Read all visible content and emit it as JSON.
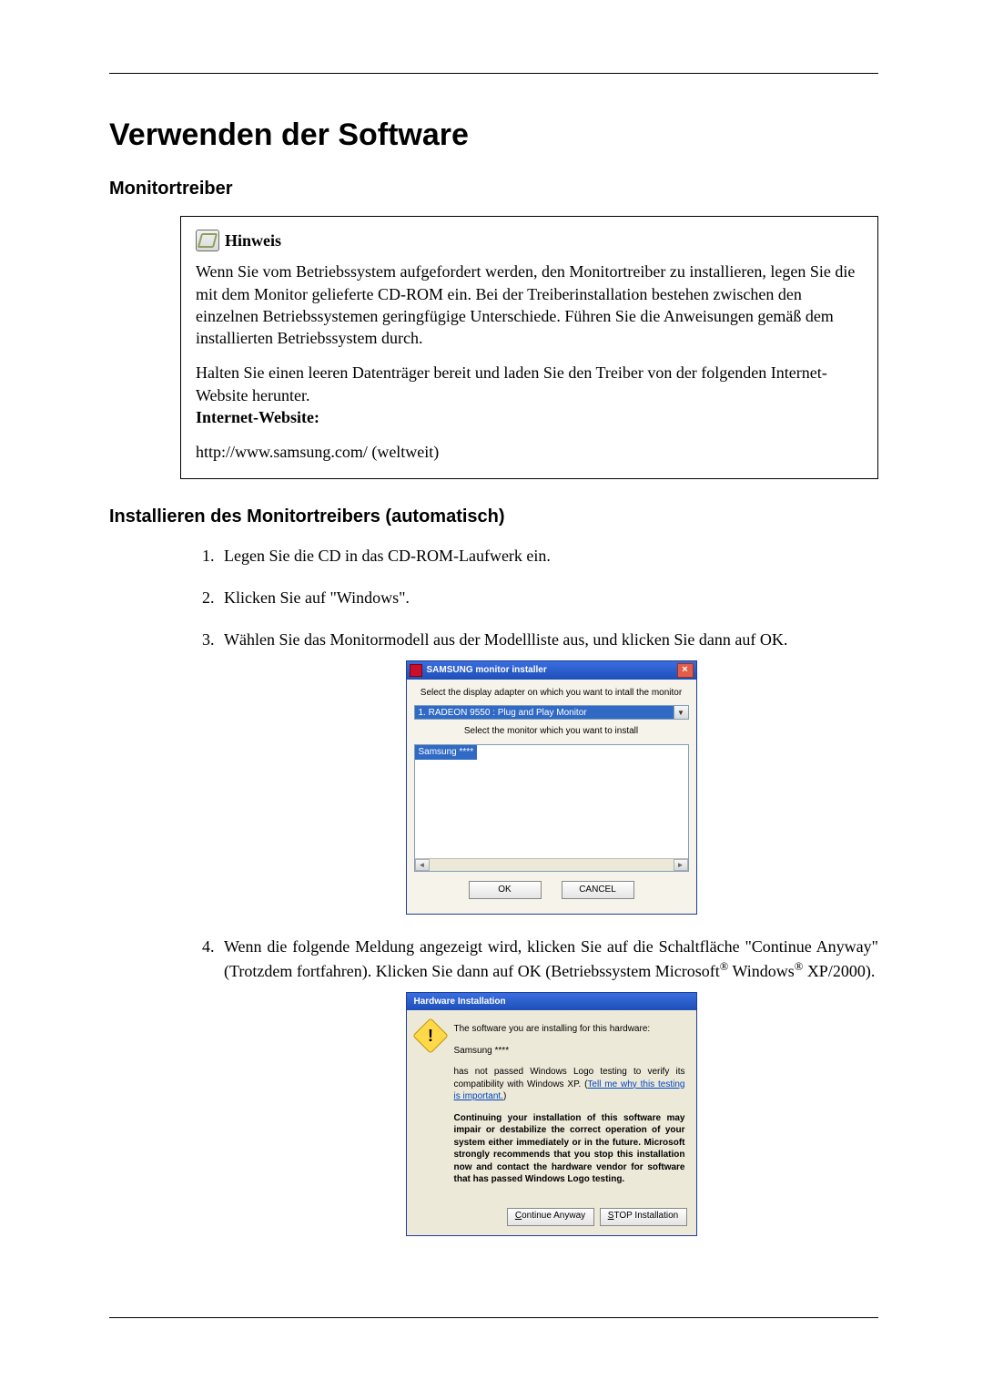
{
  "page": {
    "title": "Verwenden der Software",
    "section1": "Monitortreiber",
    "section2": "Installieren des Monitortreibers (automatisch)"
  },
  "note": {
    "label": "Hinweis",
    "p1": "Wenn Sie vom Betriebssystem aufgefordert werden, den Monitortreiber zu installieren, legen Sie die mit dem Monitor gelieferte CD-ROM ein. Bei der Treiberinstallation bestehen zwischen den einzelnen Betriebssystemen geringfügige Unterschiede. Führen Sie die Anweisungen gemäß dem installierten Betriebssystem durch.",
    "p2": "Halten Sie einen leeren Datenträger bereit und laden Sie den Treiber von der folgenden Internet-Website herunter.",
    "website_label": "Internet-Website:",
    "url": "http://www.samsung.com/ (weltweit)"
  },
  "steps": {
    "s1": "Legen Sie die CD in das CD-ROM-Laufwerk ein.",
    "s2": "Klicken Sie auf \"Windows\".",
    "s3": "Wählen Sie das Monitormodell aus der Modellliste aus, und klicken Sie dann auf OK.",
    "s4_a": "Wenn die folgende Meldung angezeigt wird, klicken Sie auf die Schaltfläche \"Continue Anyway\" (Trotzdem fortfahren). Klicken Sie dann auf OK (Betriebssystem Microsoft",
    "s4_b": " Windows",
    "s4_c": " XP/2000)."
  },
  "dlg1": {
    "title": "SAMSUNG monitor installer",
    "label1": "Select the display adapter on which you want to intall the monitor",
    "combo_value": "1. RADEON 9550 : Plug and Play Monitor",
    "label2": "Select the monitor which you want to install",
    "list_item": "Samsung ****",
    "ok": "OK",
    "cancel": "CANCEL"
  },
  "dlg2": {
    "title": "Hardware Installation",
    "p1": "The software you are installing for this hardware:",
    "p2": "Samsung ****",
    "p3a": "has not passed Windows Logo testing to verify its compatibility with Windows XP. (",
    "p3link": "Tell me why this testing is important.",
    "p3b": ")",
    "p4": "Continuing your installation of this software may impair or destabilize the correct operation of your system either immediately or in the future. Microsoft strongly recommends that you stop this installation now and contact the hardware vendor for software that has passed Windows Logo testing.",
    "btn_continue": "Continue Anyway",
    "btn_stop": "STOP Installation"
  }
}
